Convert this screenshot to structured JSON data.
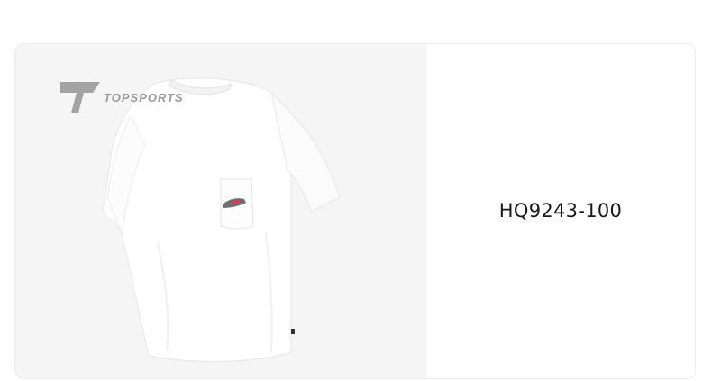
{
  "logo": {
    "text": "TOPSPORTS",
    "icon": "topsports-logo-icon"
  },
  "product": {
    "image_icon": "white-tshirt-image",
    "code": "HQ9243-100"
  },
  "colors": {
    "card_bg_left": "#f5f5f5",
    "card_bg_right": "#ffffff",
    "text": "#1a1a1a",
    "logo_gray": "#9a9a9a"
  }
}
